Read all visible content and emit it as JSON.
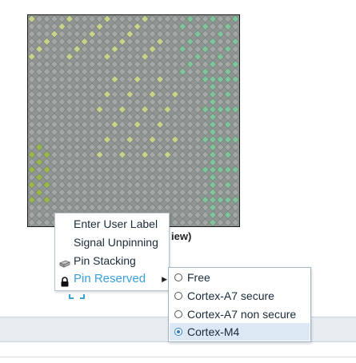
{
  "view_caption": "iew)",
  "package": {
    "pin_colors": {
      "free": "#a3a7a5",
      "cortex_a7": "#c8d48c",
      "cortex_m4": "#7fc49a",
      "assigned": "#9bb84a"
    }
  },
  "context_menu": {
    "items": [
      {
        "label": "Enter User Label",
        "icon": ""
      },
      {
        "label": "Signal Unpinning",
        "icon": ""
      },
      {
        "label": "Pin Stacking",
        "icon": "stack-icon"
      },
      {
        "label": "Pin Reserved",
        "icon": "lock-icon",
        "has_submenu": true
      }
    ]
  },
  "submenu": {
    "selected": "Cortex-M4",
    "items": [
      {
        "label": "Free"
      },
      {
        "label": "Cortex-A7 secure"
      },
      {
        "label": "Cortex-A7 non secure"
      },
      {
        "label": "Cortex-M4"
      }
    ]
  },
  "colors": {
    "accent": "#3aa0d8",
    "selection_bg": "#dce8f3",
    "status_band": "#e8edf2"
  }
}
